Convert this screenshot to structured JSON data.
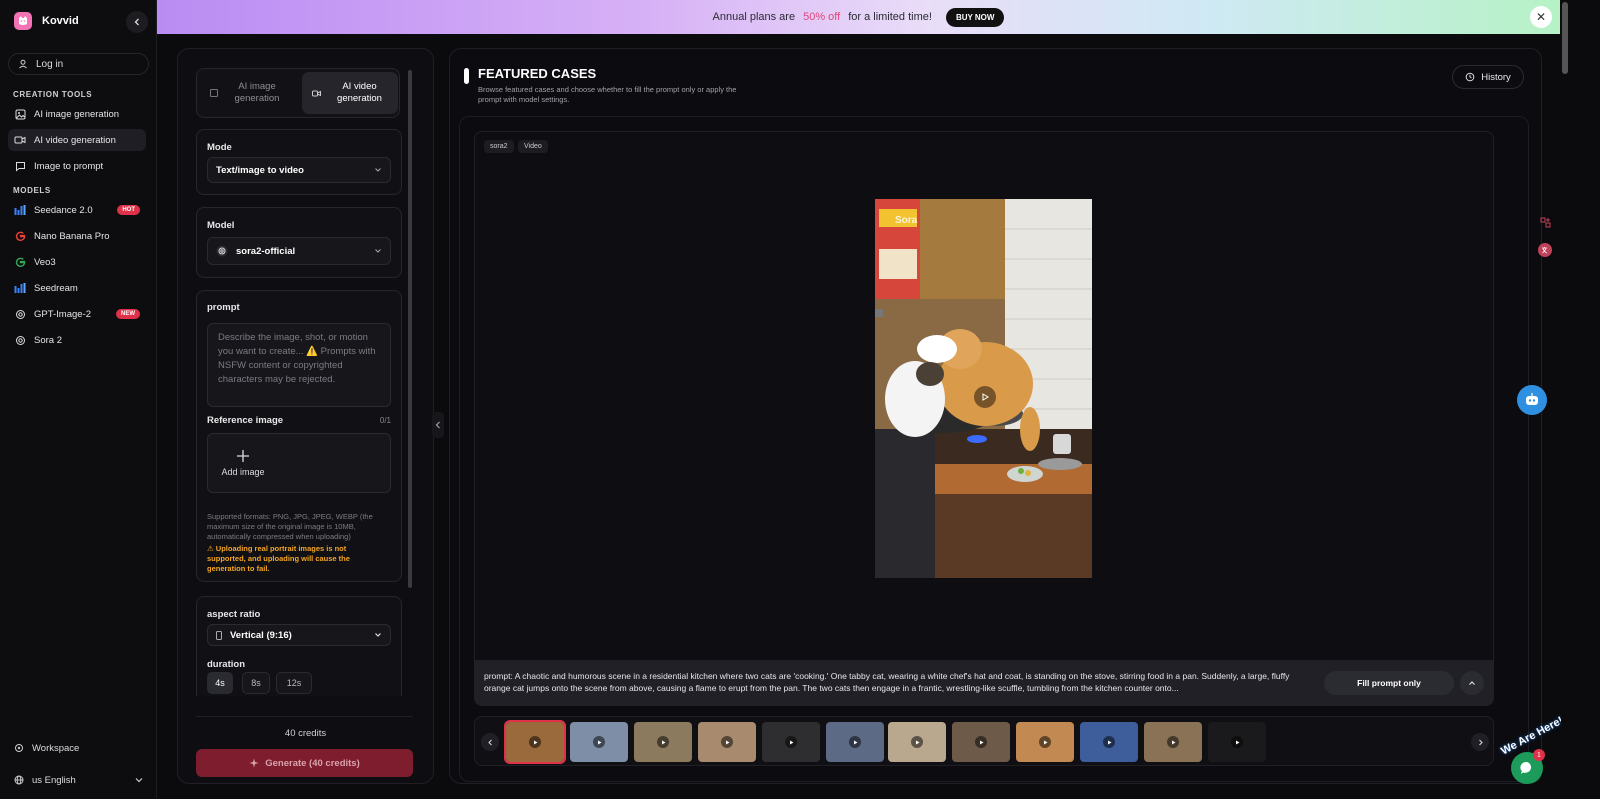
{
  "app": {
    "name": "Kovvid"
  },
  "sidebar": {
    "login": "Log in",
    "creation_title": "CREATION TOOLS",
    "creation_items": [
      {
        "label": "AI image generation",
        "icon": "image-icon"
      },
      {
        "label": "AI video generation",
        "icon": "video-icon",
        "active": true
      },
      {
        "label": "Image to prompt",
        "icon": "chat-icon"
      }
    ],
    "models_title": "MODELS",
    "models": [
      {
        "label": "Seedance 2.0",
        "icon": "bars-icon",
        "badge": "HOT"
      },
      {
        "label": "Nano Banana Pro",
        "icon": "google-icon"
      },
      {
        "label": "Veo3",
        "icon": "google-icon"
      },
      {
        "label": "Seedream",
        "icon": "bars-icon"
      },
      {
        "label": "GPT-Image-2",
        "icon": "openai-icon",
        "badge": "NEW"
      },
      {
        "label": "Sora 2",
        "icon": "openai-icon"
      }
    ],
    "workspace": "Workspace",
    "language": "us English"
  },
  "promo": {
    "text_before": "Annual plans are",
    "highlight": "50% off",
    "text_after": "for a limited time!",
    "button": "BUY NOW"
  },
  "panel": {
    "tabs": [
      "AI image generation",
      "AI video generation"
    ],
    "mode_label": "Mode",
    "mode_value": "Text/image to video",
    "model_label": "Model",
    "model_value": "sora2-official",
    "prompt_label": "prompt",
    "prompt_placeholder": "Describe the image, shot, or motion you want to create... ⚠️ Prompts with NSFW content or copyrighted characters may be rejected.",
    "reference_label": "Reference image",
    "reference_count": "0/1",
    "add_image": "Add image",
    "formats": "Supported formats: PNG, JPG, JPEG, WEBP (the maximum size of the original image is 10MB, automatically compressed when uploading)",
    "warning": "⚠ Uploading real portrait images is not supported, and uploading will cause the generation to fail.",
    "aspect_label": "aspect ratio",
    "aspect_value": "Vertical (9:16)",
    "duration_label": "duration",
    "durations": [
      "4s",
      "8s",
      "12s"
    ],
    "credits": "40 credits",
    "generate": "Generate (40 credits)"
  },
  "featured": {
    "title": "FEATURED CASES",
    "description": "Browse featured cases and choose whether to fill the prompt only or apply the prompt with model settings.",
    "history": "History",
    "tags": [
      "sora2",
      "Video"
    ],
    "watermark": "Sora",
    "prompt": "prompt: A chaotic and humorous scene in a residential kitchen where two cats are 'cooking.' One tabby cat, wearing a white chef's hat and coat, is standing on the stove, stirring food in a pan. Suddenly, a large, fluffy orange cat jumps onto the scene from above, causing a flame to erupt from the pan. The two cats then engage in a frantic, wrestling-like scuffle, tumbling from the kitchen counter onto...",
    "fill_button": "Fill prompt only"
  },
  "widgets": {
    "chat_text": "We Are Here!",
    "chat_badge": "1"
  },
  "colors": {
    "accent_red": "#e0314a",
    "generate_button": "#7d1d2e",
    "warning": "#f5a524",
    "promo_highlight": "#e0467c"
  }
}
